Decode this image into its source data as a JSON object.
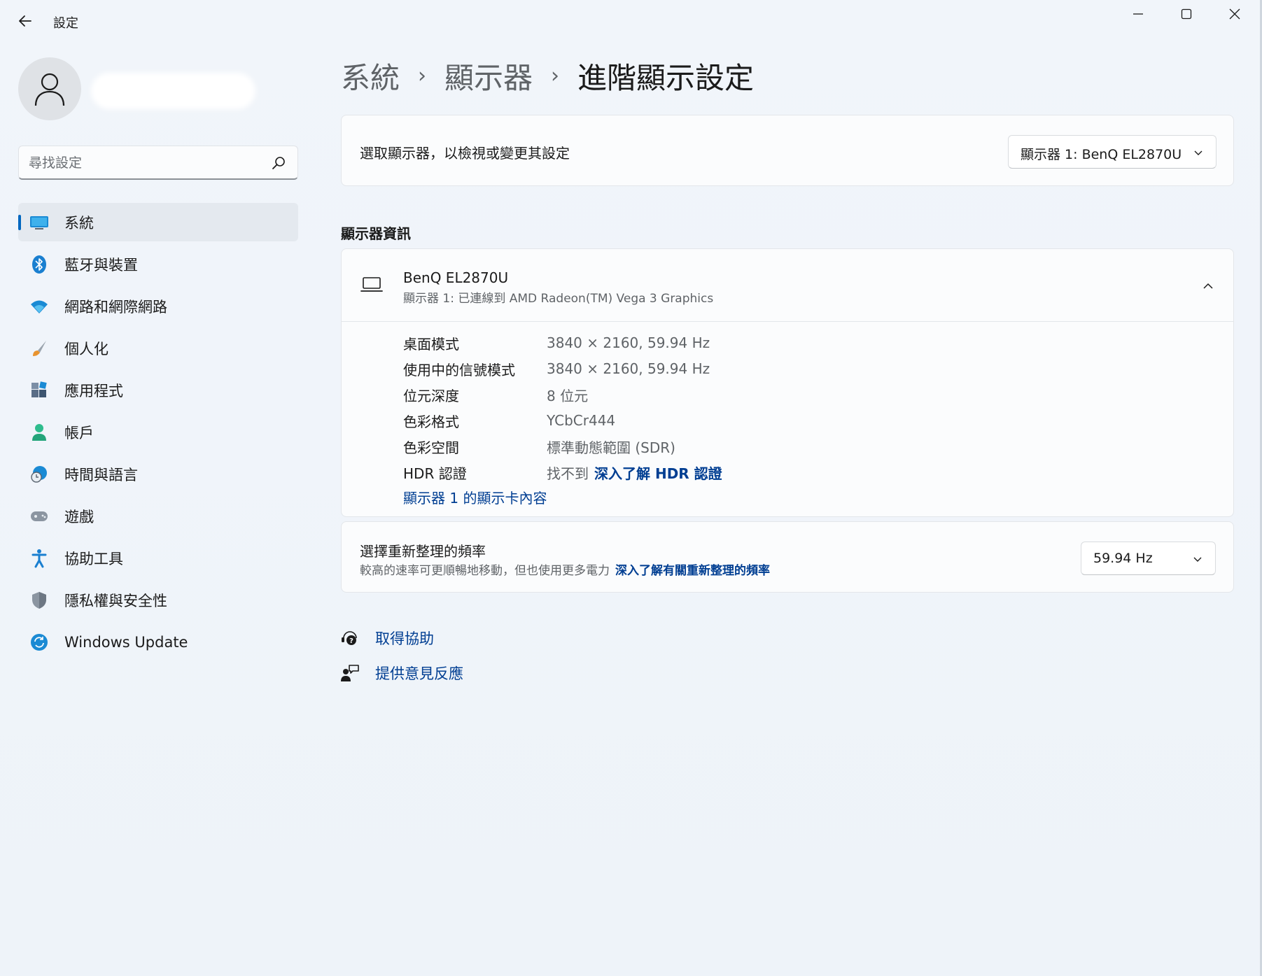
{
  "window": {
    "title": "設定"
  },
  "search": {
    "placeholder": "尋找設定"
  },
  "sidebar": {
    "items": [
      {
        "label": "系統",
        "icon": "monitor-icon",
        "active": true
      },
      {
        "label": "藍牙與裝置",
        "icon": "bluetooth-icon"
      },
      {
        "label": "網路和網際網路",
        "icon": "wifi-icon"
      },
      {
        "label": "個人化",
        "icon": "brush-icon"
      },
      {
        "label": "應用程式",
        "icon": "apps-icon"
      },
      {
        "label": "帳戶",
        "icon": "person-icon"
      },
      {
        "label": "時間與語言",
        "icon": "globe-clock-icon"
      },
      {
        "label": "遊戲",
        "icon": "gamepad-icon"
      },
      {
        "label": "協助工具",
        "icon": "accessibility-icon"
      },
      {
        "label": "隱私權與安全性",
        "icon": "shield-icon"
      },
      {
        "label": "Windows Update",
        "icon": "update-icon"
      }
    ]
  },
  "breadcrumb": [
    "系統",
    "顯示器",
    "進階顯示設定"
  ],
  "select_display": {
    "label": "選取顯示器，以檢視或變更其設定",
    "selected": "顯示器 1: BenQ EL2870U"
  },
  "display_info": {
    "heading": "顯示器資訊",
    "monitor_name": "BenQ EL2870U",
    "monitor_sub": "顯示器 1: 已連線到 AMD Radeon(TM) Vega 3 Graphics",
    "specs": [
      {
        "label": "桌面模式",
        "value": "3840 × 2160, 59.94 Hz"
      },
      {
        "label": "使用中的信號模式",
        "value": "3840 × 2160, 59.94 Hz"
      },
      {
        "label": "位元深度",
        "value": "8 位元"
      },
      {
        "label": "色彩格式",
        "value": "YCbCr444"
      },
      {
        "label": "色彩空間",
        "value": "標準動態範圍 (SDR)"
      },
      {
        "label": "HDR 認證",
        "value": "找不到",
        "link": "深入了解 HDR 認證"
      }
    ],
    "adapter_link": "顯示器 1 的顯示卡內容"
  },
  "refresh_rate": {
    "title": "選擇重新整理的頻率",
    "subtitle": "較高的速率可更順暢地移動，但也使用更多電力",
    "link": "深入了解有關重新整理的頻率",
    "selected": "59.94 Hz"
  },
  "footer": {
    "help": "取得協助",
    "feedback": "提供意見反應"
  },
  "colors": {
    "accent": "#0067c0",
    "link": "#003e92",
    "background": "#eef3f9",
    "card": "#fbfcfd"
  }
}
